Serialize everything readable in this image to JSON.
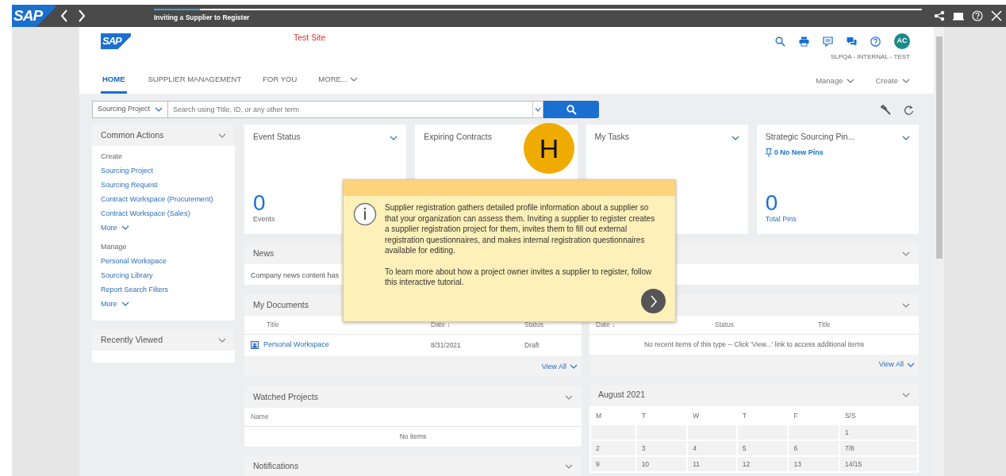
{
  "walkthrough_bar": {
    "logo": "SAP",
    "title": "Inviting a Supplier to Register",
    "level": 0.06
  },
  "header": {
    "logo": "SAP",
    "site_label": "Test Site",
    "account": "SLPQA - INTERNAL - TEST",
    "avatar": "AC"
  },
  "tabs": [
    {
      "label": "HOME",
      "selected": true,
      "kind": "link"
    },
    {
      "label": "SUPPLIER MANAGEMENT",
      "selected": false,
      "kind": "link"
    },
    {
      "label": "FOR YOU",
      "selected": false,
      "kind": "link"
    },
    {
      "label": "MORE...",
      "selected": false,
      "kind": "menu"
    }
  ],
  "header_menus": [
    "Manage",
    "Create"
  ],
  "search": {
    "scope": "Sourcing Project",
    "placeholder": "Search using Title, ID, or any other term"
  },
  "common_actions": {
    "title": "Common Actions",
    "sections": [
      {
        "heading": "Create",
        "links": [
          "Sourcing Project",
          "Sourcing Request",
          "Contract Workspace (Procurement)",
          "Contract Workspace (Sales)"
        ],
        "more": "More"
      },
      {
        "heading": "Manage",
        "links": [
          "Personal Workspace",
          "Sourcing Library",
          "Report Search Filters"
        ],
        "more": "More"
      }
    ]
  },
  "recently_viewed": {
    "title": "Recently Viewed"
  },
  "tiles": [
    {
      "title": "Event Status",
      "menu": true,
      "count": "0",
      "caption": "Events",
      "caption_link": false
    },
    {
      "title": "Expiring Contracts",
      "menu": false
    },
    {
      "title": "My Tasks",
      "menu": true
    },
    {
      "title": "Strategic Sourcing Pin...",
      "menu": true,
      "pins": "0 No New Pins",
      "count": "0",
      "caption": "Total Pins",
      "caption_link": true
    }
  ],
  "middle_column": [
    {
      "kind": "text",
      "title": "News",
      "text": "Company news content has"
    },
    {
      "kind": "table",
      "title": "My Documents",
      "columns": [
        "Title",
        "Date ↓",
        "Status"
      ],
      "rows": [
        [
          "Personal Workspace",
          "8/31/2021",
          "Draft"
        ]
      ],
      "footer": "View All"
    },
    {
      "kind": "table",
      "title": "Watched Projects",
      "columns": [
        "Name"
      ],
      "empty_text": "No items"
    },
    {
      "kind": "title",
      "title": "Notifications"
    }
  ],
  "right_column": [
    {
      "kind": "blank"
    },
    {
      "kind": "table",
      "columns": [
        "Date ↓",
        "Status",
        "Title"
      ],
      "empty_text": "No recent items of this type -- Click 'View...' link to access additional items",
      "footer": "View All"
    },
    {
      "kind": "calendar",
      "title": "August 2021",
      "days": [
        "M",
        "T",
        "W",
        "T",
        "F",
        "S/S"
      ],
      "weeks": [
        [
          "1"
        ],
        [
          "2",
          "3",
          "4",
          "5",
          "6",
          "7/8"
        ],
        [
          "9",
          "10",
          "11",
          "12",
          "13",
          "14/15"
        ]
      ]
    }
  ],
  "step_marker": "H",
  "tooltip": {
    "paragraphs": [
      "Supplier registration gathers detailed profile information about a supplier so that your organization can assess them. Inviting a supplier to register creates a supplier registration project for them, invites them to fill out external registration questionnaires, and makes internal registration questionnaires available for editing.",
      "To learn more about how a project owner invites a supplier to register, follow this interactive tutorial."
    ]
  }
}
